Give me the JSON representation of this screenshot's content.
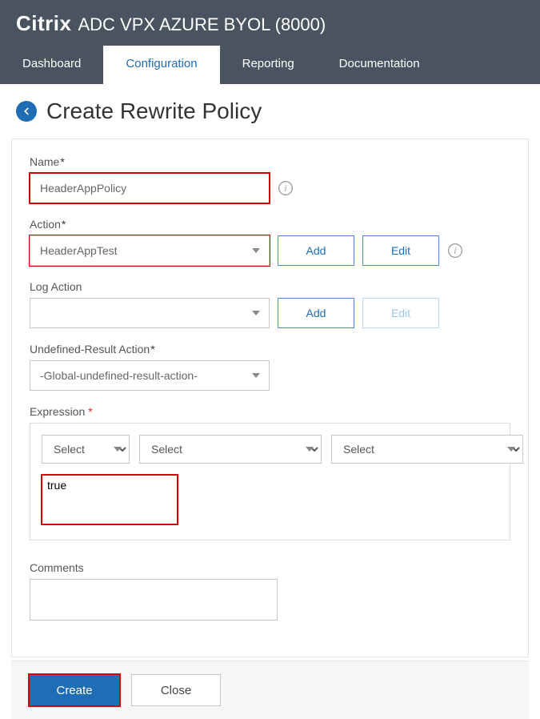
{
  "header": {
    "brand": "Citrix",
    "product": "ADC VPX AZURE BYOL (8000)"
  },
  "tabs": [
    "Dashboard",
    "Configuration",
    "Reporting",
    "Documentation"
  ],
  "active_tab": 1,
  "page_title": "Create Rewrite Policy",
  "fields": {
    "name": {
      "label": "Name",
      "value": "HeaderAppPolicy"
    },
    "action": {
      "label": "Action",
      "value": "HeaderAppTest",
      "add": "Add",
      "edit": "Edit"
    },
    "log_action": {
      "label": "Log Action",
      "value": "",
      "add": "Add",
      "edit": "Edit"
    },
    "undefined_result": {
      "label": "Undefined-Result Action",
      "value": "-Global-undefined-result-action-"
    },
    "expression": {
      "label": "Expression",
      "selects": [
        "Select",
        "Select",
        "Select"
      ],
      "value": "true"
    },
    "comments": {
      "label": "Comments",
      "value": ""
    }
  },
  "footer": {
    "create": "Create",
    "close": "Close"
  }
}
